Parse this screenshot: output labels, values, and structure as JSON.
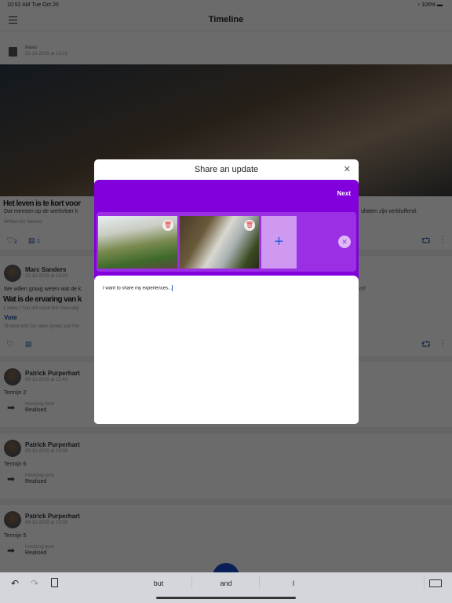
{
  "status": {
    "time": "10:52 AM  Tue Oct 20",
    "battery": "100%"
  },
  "header": {
    "title": "Timeline"
  },
  "news": {
    "category": "News",
    "date": "21-10-2019 at 15:41",
    "title": "Het leven is te kort voor",
    "body_left": "Dat mensen op de werkvloer k",
    "body_right": "ultaten zijn verbluffend.",
    "written": "Written for Nieuws",
    "likes": "2",
    "comments": "1"
  },
  "poll": {
    "author": "Marc Sanders",
    "date": "21-10-2019 at 15:40",
    "text_left": "We willen graag weten wat de k",
    "text_right": "n?",
    "title": "Wat is de ervaring van k",
    "votes": "1 votes | You will close this manually",
    "vote_label": "Vote",
    "shared": "Shared with De sales groep and Nie"
  },
  "terms": [
    {
      "author": "Patrick Purperhart",
      "date": "09-10-2019 at 12:43",
      "title": "Termijn 2",
      "label": "Invoicing term",
      "status": "Realised"
    },
    {
      "author": "Patrick Purperhart",
      "date": "08-10-2019 at 23:08",
      "title": "Termijn 6",
      "label": "Invoicing term",
      "status": "Realised"
    },
    {
      "author": "Patrick Purperhart",
      "date": "08-10-2019 at 23:08",
      "title": "Termijn 5",
      "label": "Invoicing term",
      "status": "Realised"
    }
  ],
  "modal": {
    "title": "Share an update",
    "next": "Next",
    "text": "I want  to share my experiences...",
    "accent": "#8100dc"
  },
  "keyboard": {
    "suggestions": [
      "but",
      "and",
      "I"
    ]
  }
}
